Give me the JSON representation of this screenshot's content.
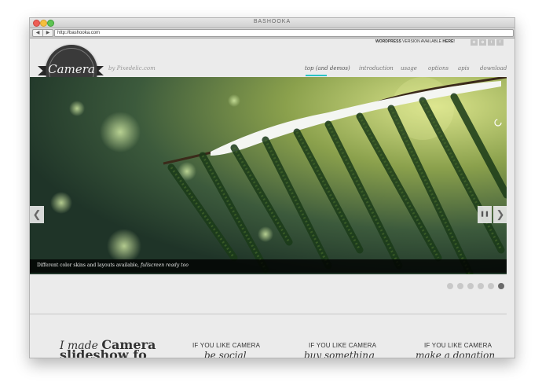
{
  "window": {
    "title": "BASHOOKA"
  },
  "browser": {
    "url": "http://bashooka.com",
    "back_label": "◀",
    "forward_label": "▶"
  },
  "header": {
    "wordpress_note_prefix": "WORDPRESS",
    "wordpress_note_middle": " VERSION AVAILABLE ",
    "wordpress_note_link": "HERE!",
    "social_icons": [
      "rss-icon",
      "dribbble-icon",
      "twitter-icon",
      "facebook-icon"
    ],
    "social_glyphs": [
      "⊚",
      "⊛",
      "t",
      "f"
    ],
    "logo_text": "Camera",
    "byline": "by Pixedelic.com",
    "menu": [
      "top (and demos)",
      "introduction",
      "usage",
      "options",
      "apis",
      "download"
    ],
    "active_menu_index": 0,
    "accent_color": "#2bc4c4"
  },
  "slider": {
    "caption_plain": "Different color skins and layouts available, ",
    "caption_italic": "fullscreen ready too",
    "prev_label": "❮",
    "next_label": "❯",
    "pause_label": "❚❚",
    "pager_count": 6,
    "active_pager_index": 5
  },
  "promo": {
    "heading_prefix": "I made ",
    "heading_bold": "Camera",
    "heading_line2": "slideshow fo",
    "columns": [
      {
        "caption": "IF YOU LIKE CAMERA",
        "sub": "be social"
      },
      {
        "caption": "IF YOU LIKE CAMERA",
        "sub": "buy something"
      },
      {
        "caption": "IF YOU LIKE CAMERA",
        "sub": "make a donation"
      }
    ]
  }
}
